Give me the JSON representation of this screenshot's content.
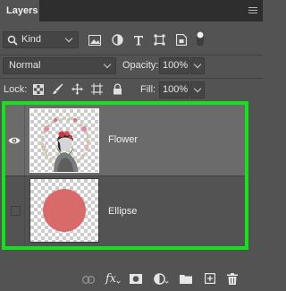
{
  "panel": {
    "tab_label": "Layers",
    "menu_icon": "panel-menu-icon"
  },
  "filter": {
    "kind_label": "Kind",
    "icons": [
      "pixel-filter-icon",
      "adjustment-filter-icon",
      "type-filter-icon",
      "shape-filter-icon",
      "smart-object-filter-icon",
      "filter-toggle-icon"
    ]
  },
  "blend": {
    "mode": "Normal",
    "opacity_label": "Opacity:",
    "opacity_value": "100%"
  },
  "lock": {
    "label": "Lock:",
    "icons": [
      "lock-transparent-icon",
      "lock-paint-icon",
      "lock-position-icon",
      "lock-artboard-icon",
      "lock-all-icon"
    ],
    "fill_label": "Fill:",
    "fill_value": "100%"
  },
  "layers": [
    {
      "name": "Flower",
      "visible": true,
      "selected": true
    },
    {
      "name": "Ellipse",
      "visible": false,
      "selected": false
    }
  ],
  "footer": {
    "fx_label": "fx",
    "icons": [
      "link-layers-icon",
      "fx-icon",
      "add-mask-icon",
      "adjustment-layer-icon",
      "new-group-icon",
      "new-layer-icon",
      "delete-layer-icon"
    ]
  },
  "colors": {
    "panel_bg": "#535353",
    "selected_row": "#6b6b6b",
    "highlight_border": "#11e51a",
    "ellipse_fill": "#d96a6a"
  }
}
